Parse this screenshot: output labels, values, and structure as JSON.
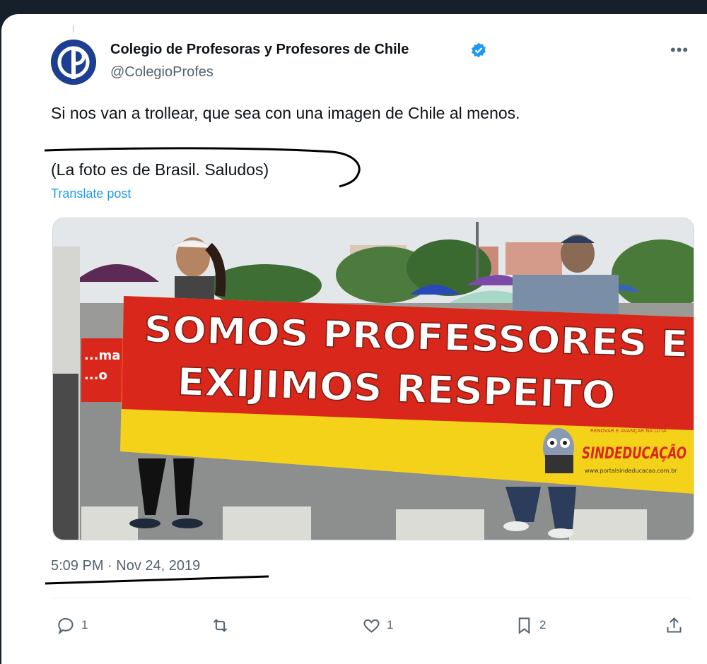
{
  "author": {
    "name": "Colegio de Profesoras y Profesores de Chile",
    "handle": "@ColegioProfes",
    "verified": true,
    "avatar_icon": "cp-logo-icon"
  },
  "post": {
    "text_line1": "Si nos van a trollear, que sea con una imagen de Chile al menos.",
    "text_line2": "(La foto es de Brasil. Saludos)",
    "translate_label": "Translate post",
    "timestamp": "5:09 PM · Nov 24, 2019"
  },
  "image": {
    "banner_line1": "SOMOS PROFESSORES E",
    "banner_line2": "EXIJIMOS RESPEITO",
    "banner_brand": "SINDEDUCAÇÃO",
    "banner_small": "RENOVAR E AVANÇAR NA LUTA",
    "banner_url": "www.portalsindeducacao.com.br",
    "side_sign": "...ma ...o"
  },
  "actions": {
    "replies": "1",
    "reposts": "",
    "likes": "1",
    "bookmarks": "2"
  },
  "colors": {
    "accent": "#1d9bf0",
    "banner_red": "#d9271c",
    "banner_yellow": "#f5d21a"
  }
}
